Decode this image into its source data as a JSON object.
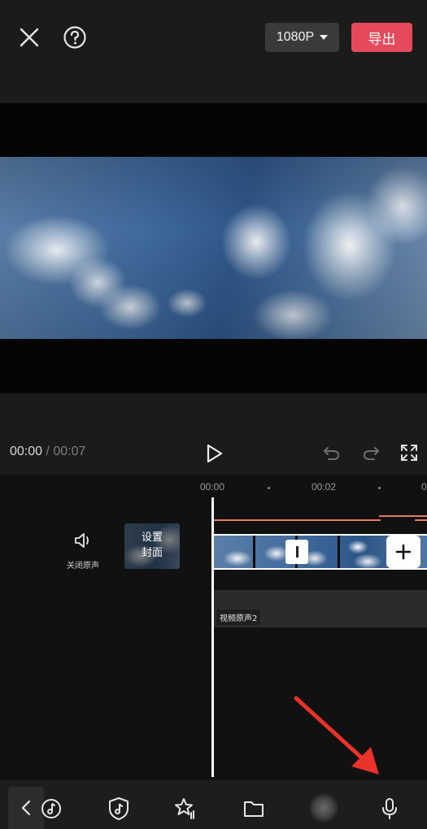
{
  "topbar": {
    "resolution": "1080P",
    "export_label": "导出"
  },
  "playback": {
    "current_time": "00:00",
    "separator": "/",
    "total_time": "00:07"
  },
  "ruler": {
    "marks": [
      "00:00",
      "00:02",
      "0"
    ]
  },
  "track": {
    "mute_label": "关闭原声",
    "cover_line1": "设置",
    "cover_line2": "封面",
    "audio_clip_label": "视频原声2"
  },
  "colors": {
    "export_button": "#e44a5b",
    "orange_line": "#e57c62",
    "annotation_arrow": "#e8322a"
  },
  "toolbar": {
    "icons": [
      "back-icon",
      "music-icon",
      "tiktok-shield-icon",
      "star-effects-icon",
      "folder-icon",
      "blurred-icon",
      "microphone-icon"
    ]
  }
}
